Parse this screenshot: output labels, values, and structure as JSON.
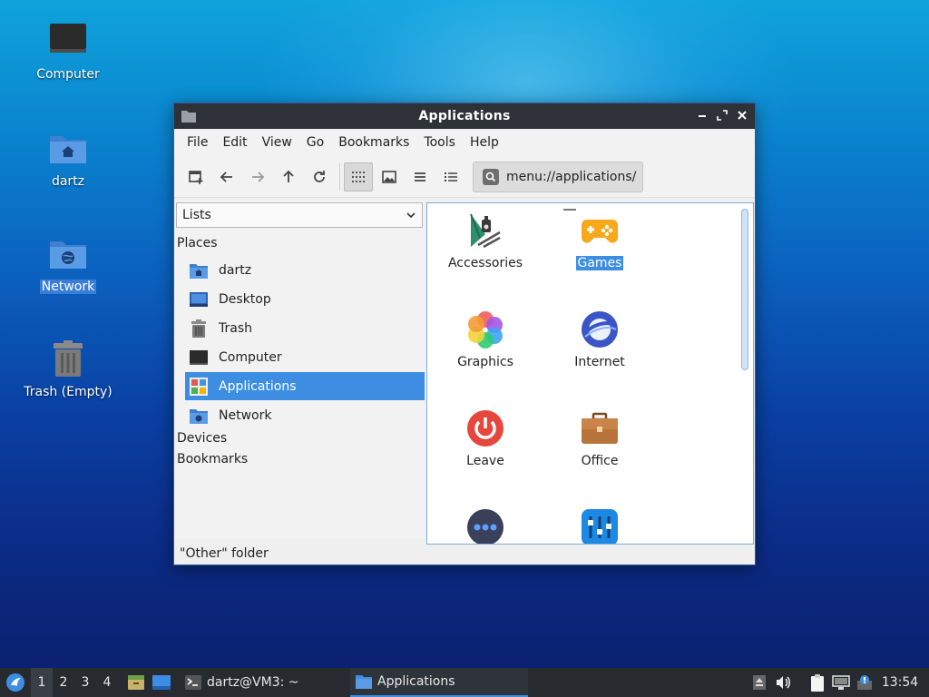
{
  "desktop": {
    "icons": [
      {
        "label": "Computer"
      },
      {
        "label": "dartz"
      },
      {
        "label": "Network"
      },
      {
        "label": "Trash (Empty)"
      }
    ]
  },
  "window": {
    "title": "Applications",
    "menu": [
      "File",
      "Edit",
      "View",
      "Go",
      "Bookmarks",
      "Tools",
      "Help"
    ],
    "location": "menu://applications/",
    "side_pane_mode": "Lists",
    "sections": {
      "places": "Places",
      "devices": "Devices",
      "bookmarks": "Bookmarks"
    },
    "places": [
      {
        "label": "dartz",
        "icon": "home-folder-icon"
      },
      {
        "label": "Desktop",
        "icon": "desktop-icon"
      },
      {
        "label": "Trash",
        "icon": "trash-icon"
      },
      {
        "label": "Computer",
        "icon": "computer-icon"
      },
      {
        "label": "Applications",
        "icon": "applications-icon"
      },
      {
        "label": "Network",
        "icon": "network-folder-icon"
      }
    ],
    "apps": [
      {
        "label": "Accessories"
      },
      {
        "label": "Games"
      },
      {
        "label": "Graphics"
      },
      {
        "label": "Internet"
      },
      {
        "label": "Leave"
      },
      {
        "label": "Office"
      },
      {
        "label": ""
      },
      {
        "label": ""
      }
    ],
    "status": "\"Other\" folder"
  },
  "taskbar": {
    "workspaces": [
      "1",
      "2",
      "3",
      "4"
    ],
    "tasks": [
      {
        "label": "dartz@VM3: ~"
      },
      {
        "label": "Applications"
      }
    ],
    "clock": "13:54"
  },
  "colors": {
    "selection": "#3d8ee3",
    "titlebar": "#2e3238",
    "taskbar": "#272b30"
  }
}
